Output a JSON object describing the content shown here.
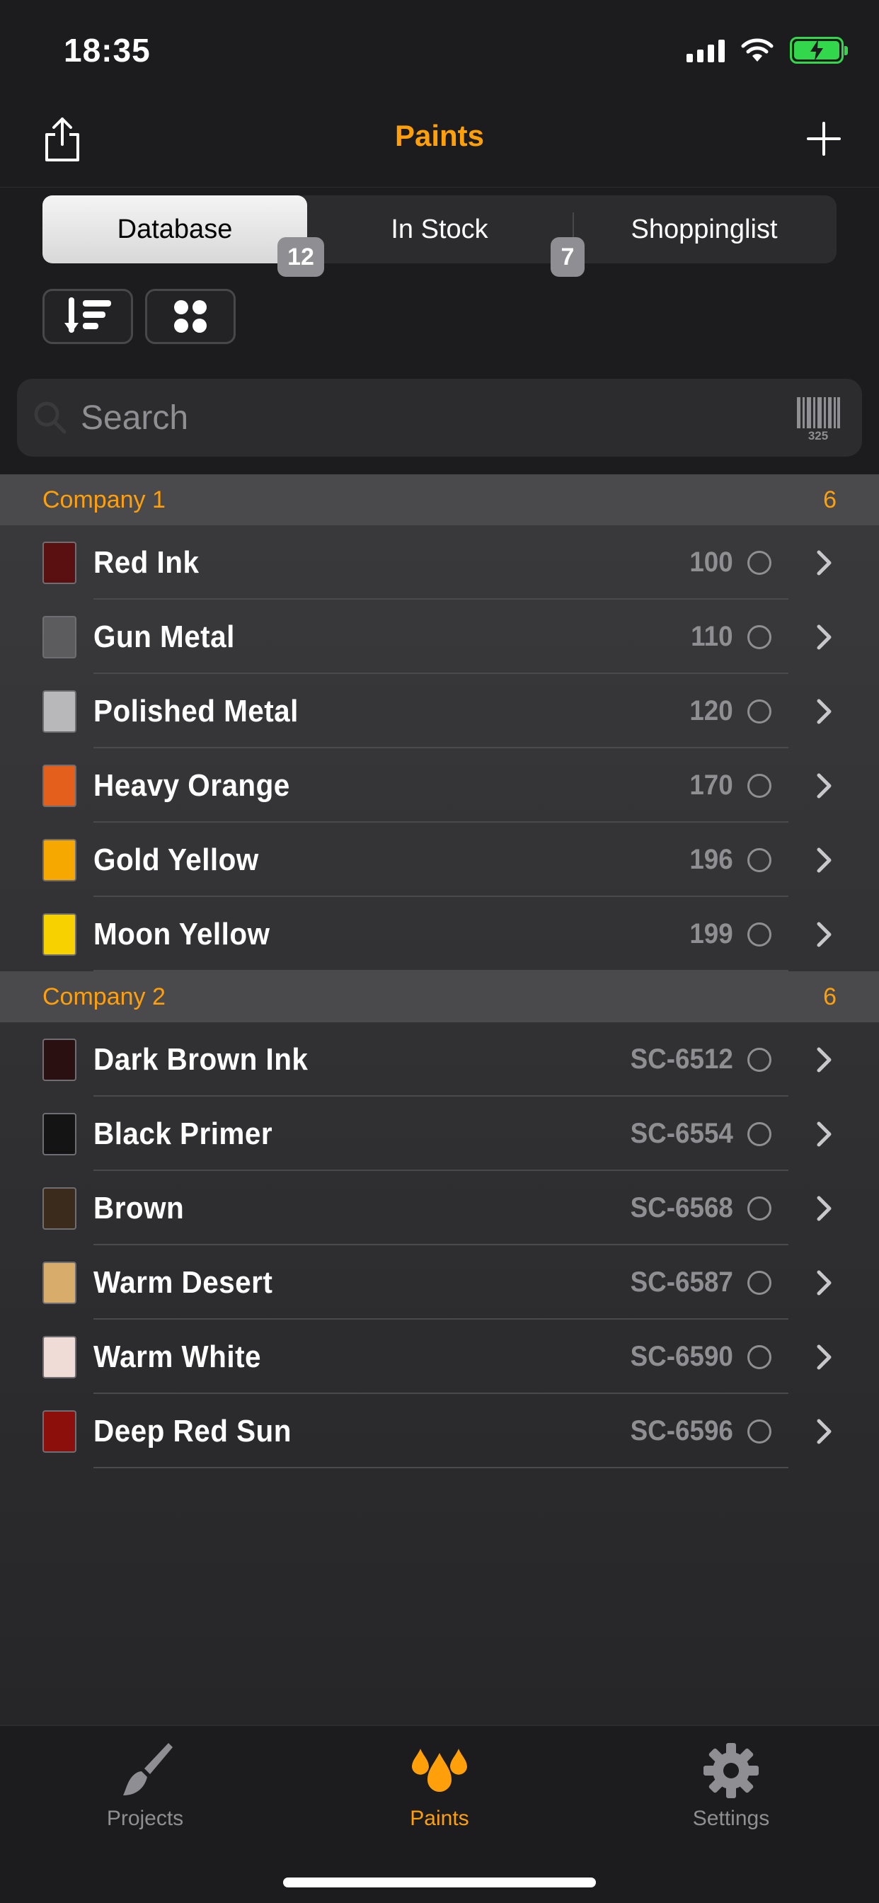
{
  "status": {
    "time": "18:35"
  },
  "nav": {
    "title": "Paints"
  },
  "segments": [
    {
      "label": "Database",
      "active": true
    },
    {
      "label": "In Stock",
      "active": false
    },
    {
      "label": "Shoppinglist",
      "active": false
    }
  ],
  "badges": {
    "database_count": "12",
    "in_stock_count": "7"
  },
  "search": {
    "placeholder": "Search",
    "barcode_number": "325"
  },
  "sections": [
    {
      "title": "Company 1",
      "count": "6",
      "items": [
        {
          "name": "Red Ink",
          "code": "100",
          "color": "#5a1010"
        },
        {
          "name": "Gun Metal",
          "code": "110",
          "color": "#5c5c5e"
        },
        {
          "name": "Polished Metal",
          "code": "120",
          "color": "#b8b8ba"
        },
        {
          "name": "Heavy Orange",
          "code": "170",
          "color": "#e35f1b"
        },
        {
          "name": "Gold Yellow",
          "code": "196",
          "color": "#f6a800"
        },
        {
          "name": "Moon Yellow",
          "code": "199",
          "color": "#f7d200"
        }
      ]
    },
    {
      "title": "Company 2",
      "count": "6",
      "items": [
        {
          "name": "Dark Brown Ink",
          "code": "SC-6512",
          "color": "#2a1010"
        },
        {
          "name": "Black Primer",
          "code": "SC-6554",
          "color": "#141414"
        },
        {
          "name": "Brown",
          "code": "SC-6568",
          "color": "#3b2b1c"
        },
        {
          "name": "Warm Desert",
          "code": "SC-6587",
          "color": "#d8ac6a"
        },
        {
          "name": "Warm White",
          "code": "SC-6590",
          "color": "#f0dcd6"
        },
        {
          "name": "Deep Red Sun",
          "code": "SC-6596",
          "color": "#8d0f0b"
        }
      ]
    }
  ],
  "tabs": [
    {
      "label": "Projects",
      "icon": "brush-icon",
      "active": false
    },
    {
      "label": "Paints",
      "icon": "paint-drops-icon",
      "active": true
    },
    {
      "label": "Settings",
      "icon": "gear-icon",
      "active": false
    }
  ],
  "colors": {
    "accent": "#ff9f0a",
    "background": "#1c1c1e"
  }
}
